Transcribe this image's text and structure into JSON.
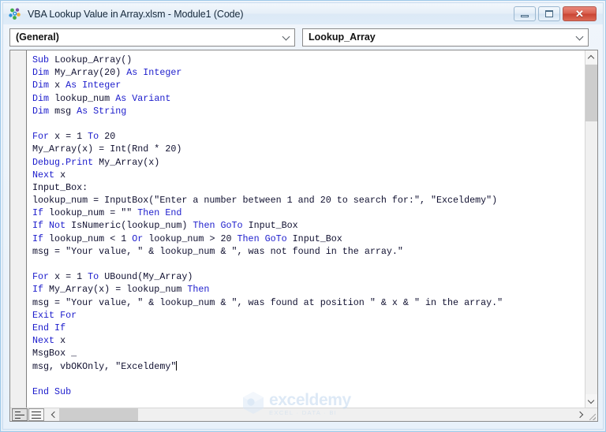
{
  "window": {
    "title": "VBA Lookup Value in Array.xlsm - Module1 (Code)",
    "icon": "vba-module-icon",
    "controls": {
      "minimize_label": "–",
      "maximize_label": "□",
      "close_label": "✕"
    }
  },
  "toolbar": {
    "object_combo": {
      "value": "(General)",
      "arrow_icon": "chevron-down-icon"
    },
    "procedure_combo": {
      "value": "Lookup_Array",
      "arrow_icon": "chevron-down-icon"
    }
  },
  "code": {
    "lines": [
      [
        {
          "t": "Sub ",
          "k": true
        },
        {
          "t": "Lookup_Array()",
          "k": false
        }
      ],
      [
        {
          "t": "Dim ",
          "k": true
        },
        {
          "t": "My_Array(20) ",
          "k": false
        },
        {
          "t": "As Integer",
          "k": true
        }
      ],
      [
        {
          "t": "Dim ",
          "k": true
        },
        {
          "t": "x ",
          "k": false
        },
        {
          "t": "As Integer",
          "k": true
        }
      ],
      [
        {
          "t": "Dim ",
          "k": true
        },
        {
          "t": "lookup_num ",
          "k": false
        },
        {
          "t": "As Variant",
          "k": true
        }
      ],
      [
        {
          "t": "Dim ",
          "k": true
        },
        {
          "t": "msg ",
          "k": false
        },
        {
          "t": "As String",
          "k": true
        }
      ],
      [
        {
          "t": "",
          "k": false
        }
      ],
      [
        {
          "t": "For ",
          "k": true
        },
        {
          "t": "x = 1 ",
          "k": false
        },
        {
          "t": "To ",
          "k": true
        },
        {
          "t": "20",
          "k": false
        }
      ],
      [
        {
          "t": "My_Array(x) = Int(Rnd * 20)",
          "k": false
        }
      ],
      [
        {
          "t": "Debug.Print ",
          "k": true
        },
        {
          "t": "My_Array(x)",
          "k": false
        }
      ],
      [
        {
          "t": "Next ",
          "k": true
        },
        {
          "t": "x",
          "k": false
        }
      ],
      [
        {
          "t": "Input_Box:",
          "k": false
        }
      ],
      [
        {
          "t": "lookup_num = InputBox(\"Enter a number between 1 and 20 to search for:\", \"Exceldemy\")",
          "k": false
        }
      ],
      [
        {
          "t": "If ",
          "k": true
        },
        {
          "t": "lookup_num = \"\" ",
          "k": false
        },
        {
          "t": "Then End",
          "k": true
        }
      ],
      [
        {
          "t": "If Not ",
          "k": true
        },
        {
          "t": "IsNumeric(lookup_num) ",
          "k": false
        },
        {
          "t": "Then GoTo ",
          "k": true
        },
        {
          "t": "Input_Box",
          "k": false
        }
      ],
      [
        {
          "t": "If ",
          "k": true
        },
        {
          "t": "lookup_num < 1 ",
          "k": false
        },
        {
          "t": "Or ",
          "k": true
        },
        {
          "t": "lookup_num > 20 ",
          "k": false
        },
        {
          "t": "Then GoTo ",
          "k": true
        },
        {
          "t": "Input_Box",
          "k": false
        }
      ],
      [
        {
          "t": "msg = \"Your value, \" & lookup_num & \", was not found in the array.\"",
          "k": false
        }
      ],
      [
        {
          "t": "",
          "k": false
        }
      ],
      [
        {
          "t": "For ",
          "k": true
        },
        {
          "t": "x = 1 ",
          "k": false
        },
        {
          "t": "To ",
          "k": true
        },
        {
          "t": "UBound(My_Array)",
          "k": false
        }
      ],
      [
        {
          "t": "If ",
          "k": true
        },
        {
          "t": "My_Array(x) = lookup_num ",
          "k": false
        },
        {
          "t": "Then",
          "k": true
        }
      ],
      [
        {
          "t": "msg = \"Your value, \" & lookup_num & \", was found at position \" & x & \" in the array.\"",
          "k": false
        }
      ],
      [
        {
          "t": "Exit For",
          "k": true
        }
      ],
      [
        {
          "t": "End If",
          "k": true
        }
      ],
      [
        {
          "t": "Next ",
          "k": true
        },
        {
          "t": "x",
          "k": false
        }
      ],
      [
        {
          "t": "MsgBox _",
          "k": false
        }
      ],
      [
        {
          "t": "msg, vbOKOnly, \"Exceldemy\"",
          "k": false,
          "cursor": true
        }
      ],
      [
        {
          "t": "",
          "k": false
        }
      ],
      [
        {
          "t": "End Sub",
          "k": true
        }
      ]
    ]
  },
  "scrollbars": {
    "vertical": {
      "up_icon": "chevron-up-icon",
      "down_icon": "chevron-down-icon"
    },
    "horizontal": {
      "left_icon": "chevron-left-icon",
      "right_icon": "chevron-right-icon"
    }
  },
  "view_buttons": {
    "procedure_view": "procedure-view-icon",
    "full_module_view": "full-module-view-icon"
  },
  "watermark": {
    "name": "exceldemy",
    "tagline": "EXCEL  ·  DATA  ·  BI"
  },
  "colors": {
    "keyword_blue": "#1c1ccc",
    "code_text": "#101030",
    "frame_blue": "#9ec8e8",
    "close_red": "#c94433",
    "watermark_blue": "#c2d8ef"
  }
}
